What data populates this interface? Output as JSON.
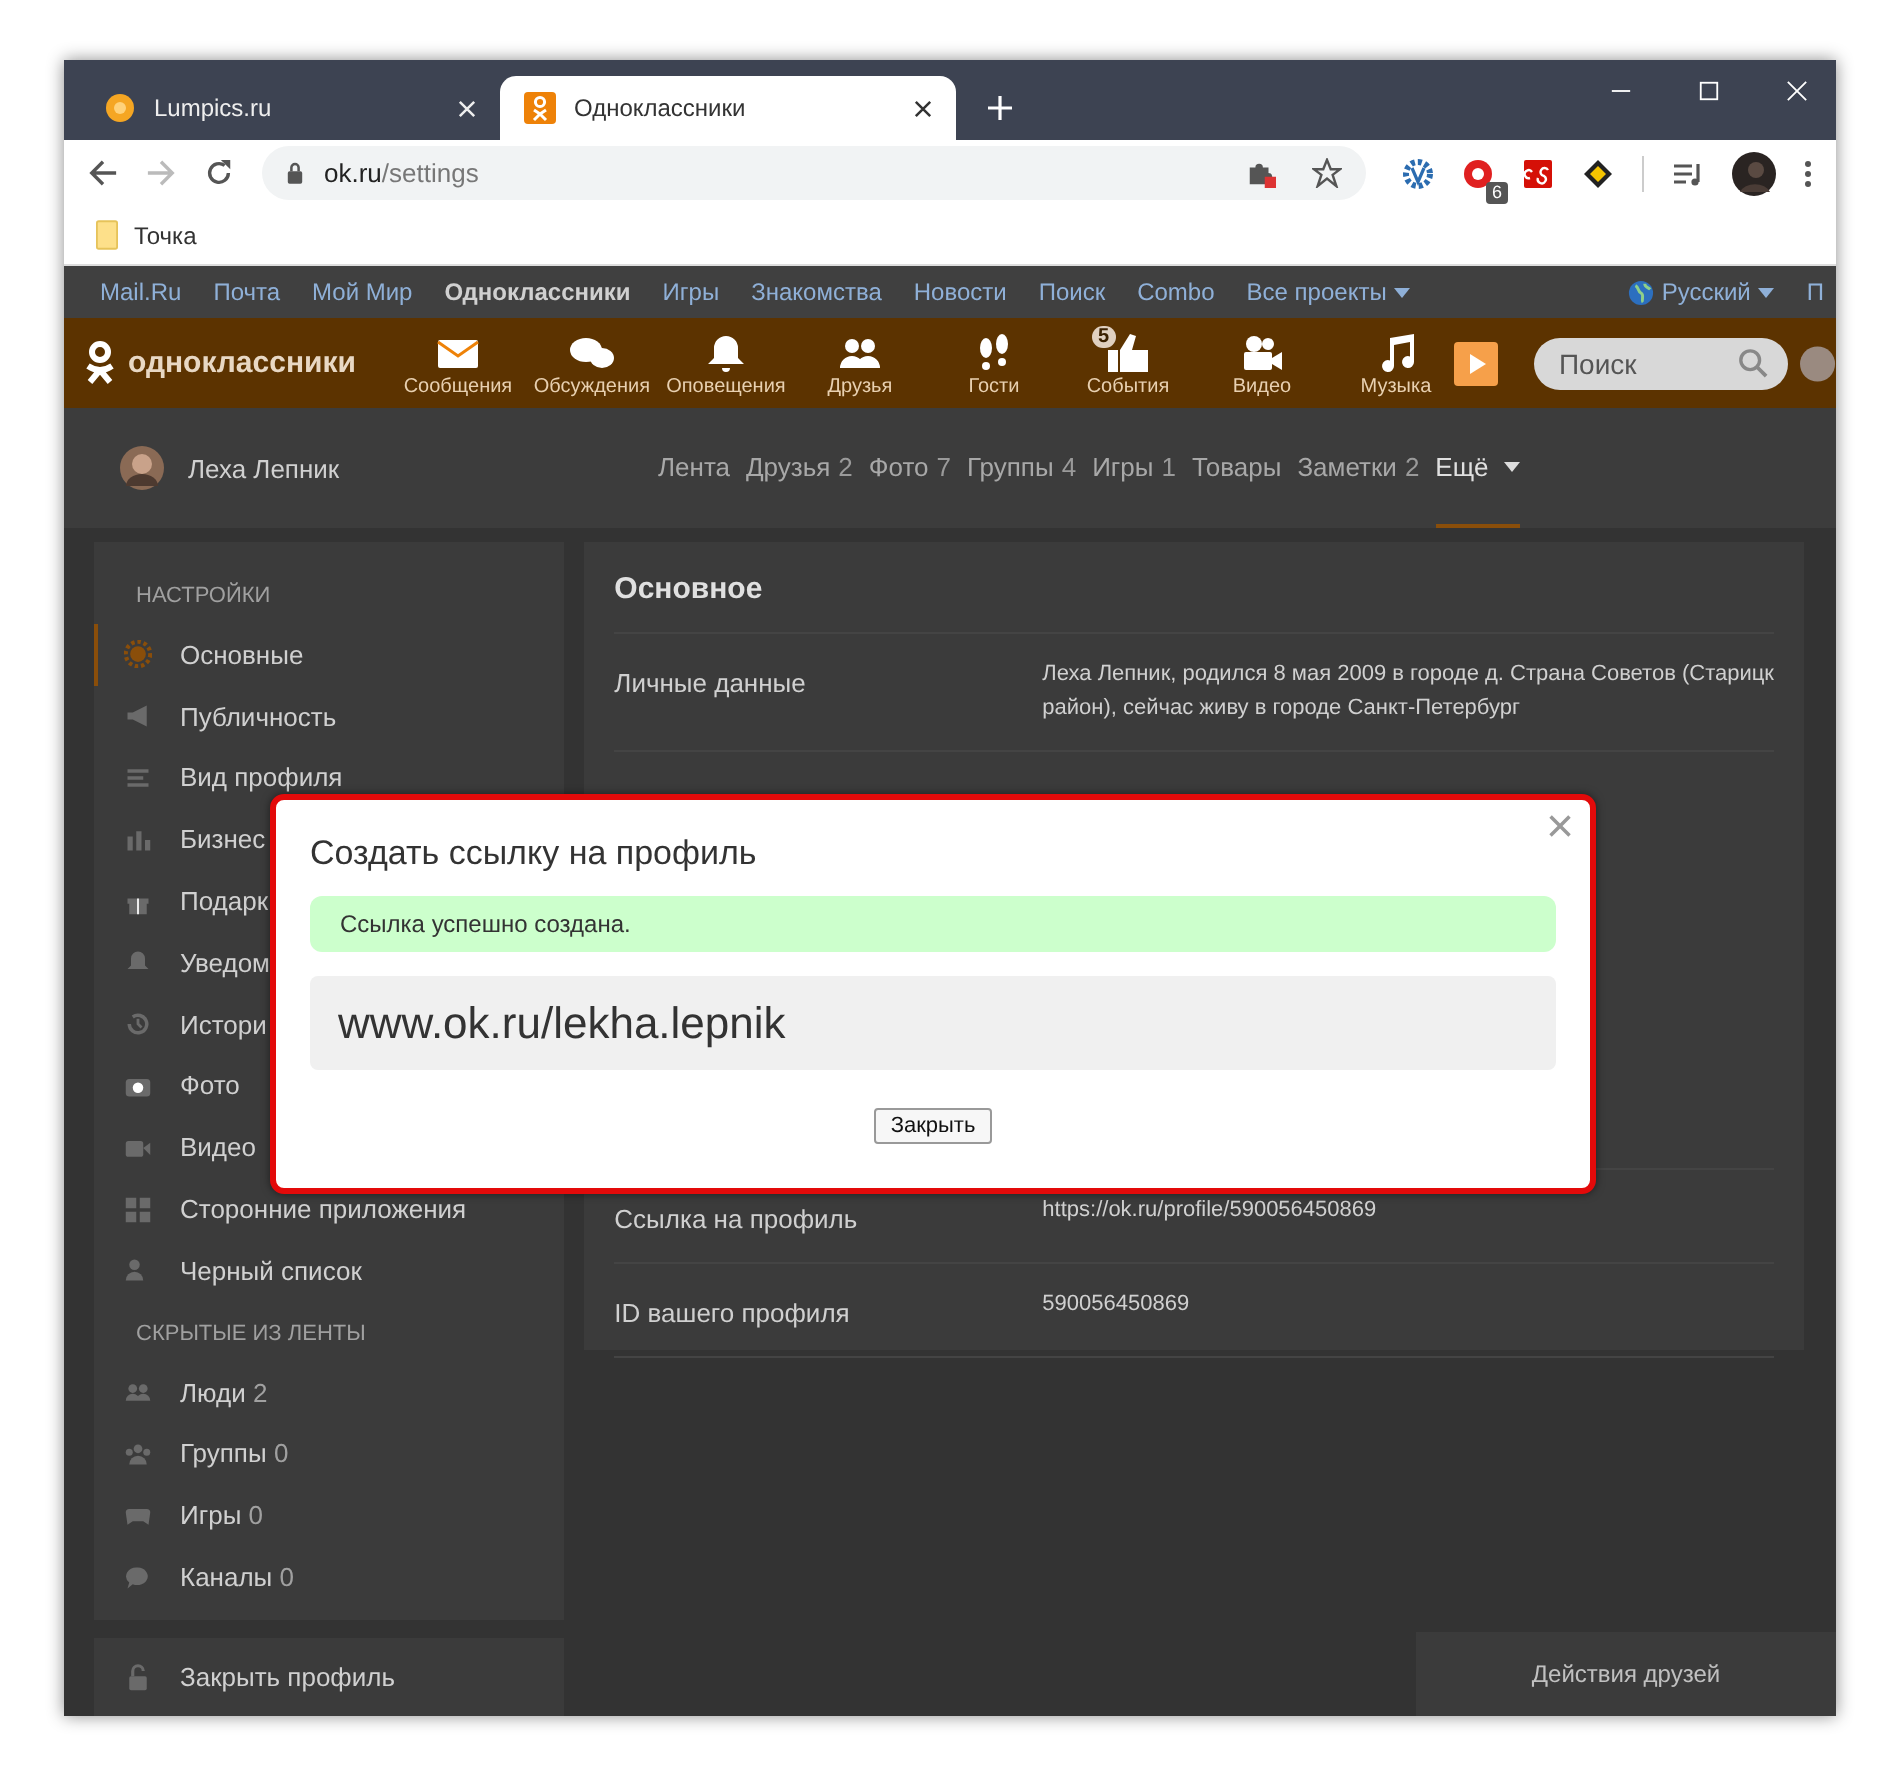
{
  "browser": {
    "tabs": [
      {
        "title": "Lumpics.ru",
        "selected": false
      },
      {
        "title": "Одноклассники",
        "selected": true
      }
    ],
    "address": {
      "host": "ok.ru",
      "path": "/settings"
    },
    "extension_badge": "6",
    "bookmarks": [
      "Точка"
    ]
  },
  "topbar": {
    "links": [
      {
        "label": "Mail.Ru",
        "selected": false
      },
      {
        "label": "Почта",
        "selected": false
      },
      {
        "label": "Мой Мир",
        "selected": false
      },
      {
        "label": "Одноклассники",
        "selected": true
      },
      {
        "label": "Игры",
        "selected": false
      },
      {
        "label": "Знакомства",
        "selected": false
      },
      {
        "label": "Новости",
        "selected": false
      },
      {
        "label": "Поиск",
        "selected": false
      },
      {
        "label": "Combo",
        "selected": false
      }
    ],
    "more": "Все проекты",
    "language": "Русский",
    "cut_link": "П"
  },
  "header": {
    "logo": "одноклассники",
    "nav": [
      "Сообщения",
      "Обсуждения",
      "Оповещения",
      "Друзья",
      "Гости",
      "События",
      "Видео",
      "Музыка"
    ],
    "events_badge": "5",
    "search": {
      "placeholder": "Поиск"
    }
  },
  "profile": {
    "name": "Леха Лепник",
    "tabs": [
      {
        "label": "Лента",
        "selected": false
      },
      {
        "label": "Друзья",
        "count": "2",
        "selected": false
      },
      {
        "label": "Фото",
        "count": "7",
        "selected": false
      },
      {
        "label": "Группы",
        "count": "4",
        "selected": false
      },
      {
        "label": "Игры",
        "count": "1",
        "selected": false
      },
      {
        "label": "Товары",
        "selected": false
      },
      {
        "label": "Заметки",
        "count": "2",
        "selected": false
      },
      {
        "label": "Ещё",
        "selected": true
      }
    ]
  },
  "sidebar": {
    "title": "НАСТРОЙКИ",
    "items": [
      {
        "label": "Основные",
        "selected": true
      },
      {
        "label": "Публичность",
        "selected": false
      },
      {
        "label": "Вид профиля",
        "selected": false
      },
      {
        "label": "Бизнес",
        "selected": false
      },
      {
        "label": "Подарк",
        "selected": false
      },
      {
        "label": "Уведом",
        "selected": false
      },
      {
        "label": "Истори",
        "selected": false
      },
      {
        "label": "Фото",
        "selected": false
      },
      {
        "label": "Видео",
        "selected": false
      },
      {
        "label": "Сторонние приложения",
        "selected": false
      },
      {
        "label": "Черный список",
        "selected": false
      }
    ],
    "hidden_title": "СКРЫТЫЕ ИЗ ЛЕНТЫ",
    "hidden_items": [
      {
        "label": "Люди",
        "count": "2"
      },
      {
        "label": "Группы",
        "count": "0"
      },
      {
        "label": "Игры",
        "count": "0"
      },
      {
        "label": "Каналы",
        "count": "0"
      }
    ],
    "footer": "Закрыть профиль"
  },
  "main": {
    "title": "Основное",
    "rows": [
      {
        "label": "Личные данные",
        "value_lines": [
          "Леха Лепник, родился 8 мая 2009 в городе д. Страна Советов (Старицк",
          "район), сейчас живу в городе Санкт-Петербург"
        ]
      },
      {
        "label": "Ссылка на профиль",
        "value_lines": [
          "https://ok.ru/profile/590056450869"
        ]
      },
      {
        "label": "ID вашего профиля",
        "value_lines": [
          "590056450869"
        ]
      }
    ]
  },
  "friends_panel": "Действия друзей",
  "modal": {
    "title": "Создать ссылку на профиль",
    "close": "×",
    "success": "Ссылка успешно создана.",
    "link": "www.ok.ru/lekha.lepnik",
    "button": "Закрыть"
  }
}
